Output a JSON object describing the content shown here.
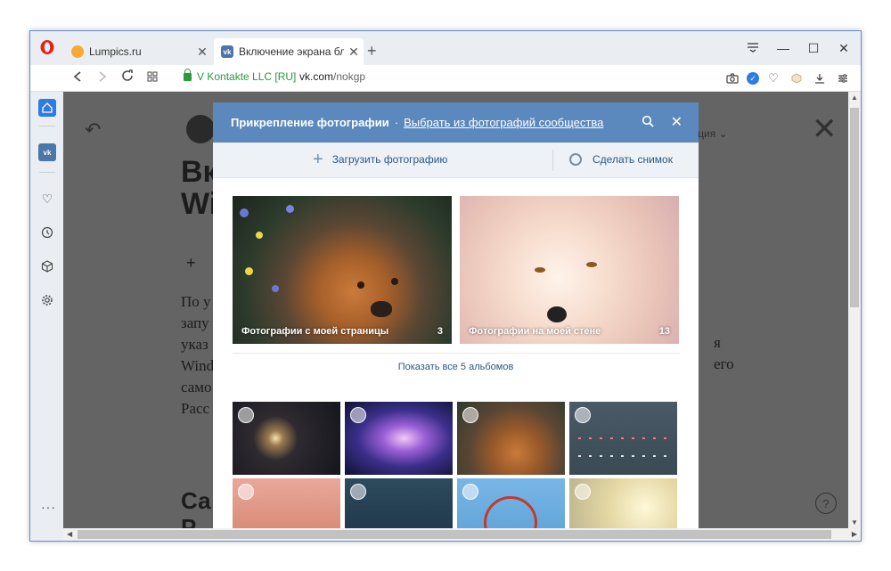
{
  "browser": {
    "tabs": [
      {
        "title": "Lumpics.ru",
        "icon": "lumpics-favicon"
      },
      {
        "title": "Включение экрана блокир",
        "icon": "vk-favicon"
      }
    ],
    "new_tab": "+",
    "window_controls": {
      "minimize": "—",
      "maximize": "☐",
      "close": "✕",
      "menu": "≡"
    },
    "address": {
      "secure_label": "V Kontakte LLC [RU]",
      "host": "vk.com",
      "path": "/nokgp"
    }
  },
  "page": {
    "heading_fragment": "Вк\nWi",
    "paragraph_fragments": [
      "По у",
      "запу",
      "указ",
      "Wind",
      "само",
      "Расс"
    ],
    "right_fragments": [
      "я",
      "его"
    ],
    "subheading_fragment": "Са\nР",
    "menu_fragment": "кация ⌄",
    "help": "?"
  },
  "modal": {
    "title": "Прикрепление фотографии",
    "separator": "·",
    "link": "Выбрать из фотографий сообщества",
    "upload_label": "Загрузить фотографию",
    "snapshot_label": "Сделать снимок",
    "albums": [
      {
        "caption": "Фотографии с моей страницы",
        "count": "3"
      },
      {
        "caption": "Фотографии на моей стене",
        "count": "13"
      }
    ],
    "show_all": "Показать все 5 альбомов"
  },
  "colors": {
    "vk_header": "#5b88bd",
    "vk_link": "#2a5885",
    "opera_red": "#e3231b",
    "accent_blue": "#2d7be5"
  }
}
